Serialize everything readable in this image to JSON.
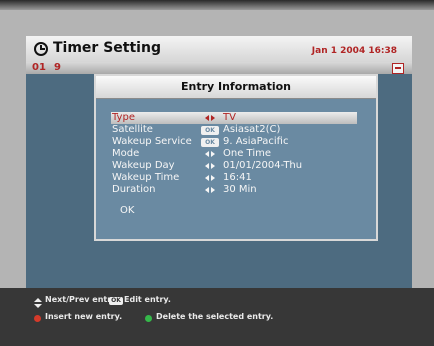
{
  "header": {
    "title": "Timer Setting",
    "datetime": "Jan 1 2004 16:38"
  },
  "timer_row": {
    "number": "01",
    "channel": "9"
  },
  "dialog": {
    "title": "Entry Information",
    "fields": [
      {
        "label": "Type",
        "control": "arrows",
        "value": "TV"
      },
      {
        "label": "Satellite",
        "control": "ok",
        "value": "Asiasat2(C)"
      },
      {
        "label": "Wakeup Service",
        "control": "ok",
        "value": "9. AsiaPacific"
      },
      {
        "label": "Mode",
        "control": "arrows",
        "value": "One Time"
      },
      {
        "label": "Wakeup Day",
        "control": "arrows",
        "value": "01/01/2004-Thu"
      },
      {
        "label": "Wakeup Time",
        "control": "arrows",
        "value": "16:41"
      },
      {
        "label": "Duration",
        "control": "arrows",
        "value": "30 Min"
      }
    ],
    "ok_label": "OK",
    "ok_badge": "OK"
  },
  "footer": {
    "next_prev": "Next/Prev entry.",
    "ok_badge": "OK",
    "edit_entry": "Edit entry.",
    "insert_entry": "Insert new entry.",
    "delete_entry": "Delete the selected entry."
  }
}
